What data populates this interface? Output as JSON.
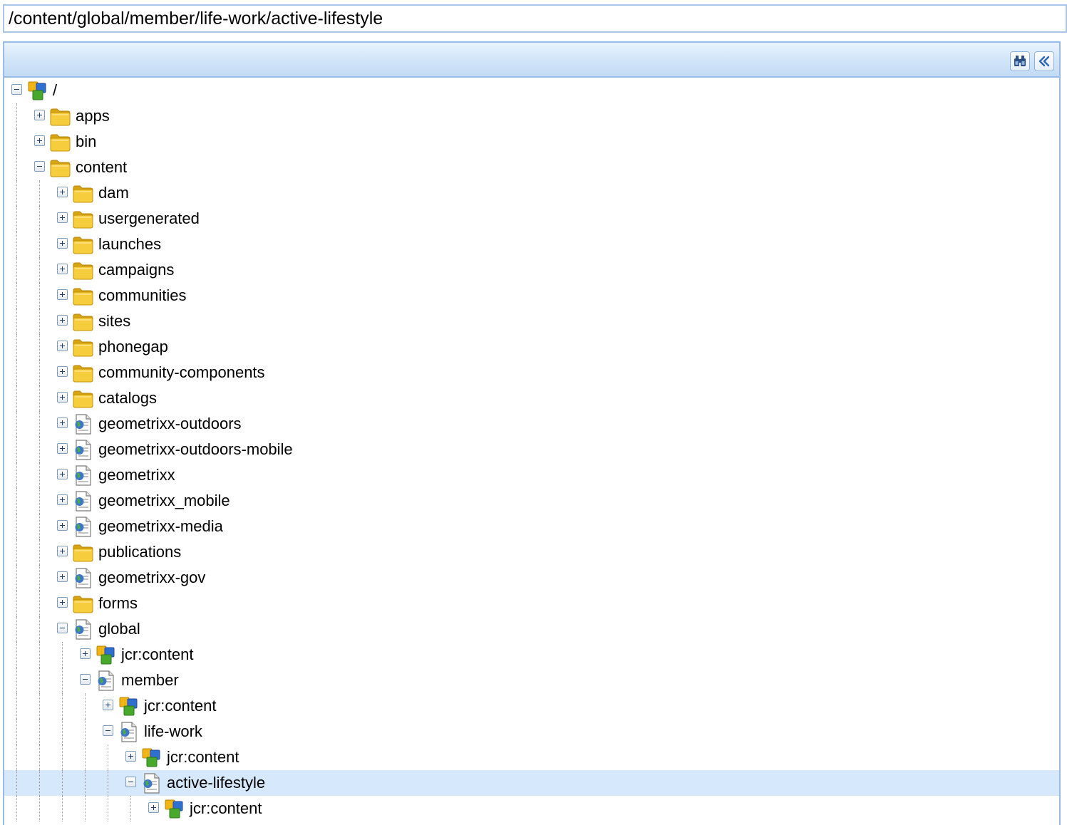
{
  "path_field": {
    "value": "/content/global/member/life-work/active-lifestyle"
  },
  "toolbar": {
    "find_icon": "binoculars-icon",
    "collapse_icon": "double-chevron-left-icon"
  },
  "colors": {
    "toolbar_bg": "#d0e4f8",
    "border": "#99bbe8",
    "selection": "#d6e8fb",
    "folder": "#f3c530"
  },
  "tree": [
    {
      "label": "/",
      "level": 0,
      "icon": "root-node-icon",
      "state": "expanded"
    },
    {
      "label": "apps",
      "level": 1,
      "icon": "folder-icon",
      "state": "collapsed"
    },
    {
      "label": "bin",
      "level": 1,
      "icon": "folder-icon",
      "state": "collapsed"
    },
    {
      "label": "content",
      "level": 1,
      "icon": "folder-icon",
      "state": "expanded"
    },
    {
      "label": "dam",
      "level": 2,
      "icon": "folder-icon",
      "state": "collapsed"
    },
    {
      "label": "usergenerated",
      "level": 2,
      "icon": "folder-icon",
      "state": "collapsed"
    },
    {
      "label": "launches",
      "level": 2,
      "icon": "folder-icon",
      "state": "collapsed"
    },
    {
      "label": "campaigns",
      "level": 2,
      "icon": "folder-icon",
      "state": "collapsed"
    },
    {
      "label": "communities",
      "level": 2,
      "icon": "folder-icon",
      "state": "collapsed"
    },
    {
      "label": "sites",
      "level": 2,
      "icon": "folder-icon",
      "state": "collapsed"
    },
    {
      "label": "phonegap",
      "level": 2,
      "icon": "folder-icon",
      "state": "collapsed"
    },
    {
      "label": "community-components",
      "level": 2,
      "icon": "folder-icon",
      "state": "collapsed"
    },
    {
      "label": "catalogs",
      "level": 2,
      "icon": "folder-icon",
      "state": "collapsed"
    },
    {
      "label": "geometrixx-outdoors",
      "level": 2,
      "icon": "page-icon",
      "state": "collapsed"
    },
    {
      "label": "geometrixx-outdoors-mobile",
      "level": 2,
      "icon": "page-icon",
      "state": "collapsed"
    },
    {
      "label": "geometrixx",
      "level": 2,
      "icon": "page-icon",
      "state": "collapsed"
    },
    {
      "label": "geometrixx_mobile",
      "level": 2,
      "icon": "page-icon",
      "state": "collapsed"
    },
    {
      "label": "geometrixx-media",
      "level": 2,
      "icon": "page-icon",
      "state": "collapsed"
    },
    {
      "label": "publications",
      "level": 2,
      "icon": "folder-icon",
      "state": "collapsed"
    },
    {
      "label": "geometrixx-gov",
      "level": 2,
      "icon": "page-icon",
      "state": "collapsed"
    },
    {
      "label": "forms",
      "level": 2,
      "icon": "folder-icon",
      "state": "collapsed"
    },
    {
      "label": "global",
      "level": 2,
      "icon": "page-icon",
      "state": "expanded"
    },
    {
      "label": "jcr:content",
      "level": 3,
      "icon": "node-icon",
      "state": "collapsed"
    },
    {
      "label": "member",
      "level": 3,
      "icon": "page-icon",
      "state": "expanded"
    },
    {
      "label": "jcr:content",
      "level": 4,
      "icon": "node-icon",
      "state": "collapsed"
    },
    {
      "label": "life-work",
      "level": 4,
      "icon": "page-icon",
      "state": "expanded"
    },
    {
      "label": "jcr:content",
      "level": 5,
      "icon": "node-icon",
      "state": "collapsed"
    },
    {
      "label": "active-lifestyle",
      "level": 5,
      "icon": "page-icon",
      "state": "expanded",
      "selected": true
    },
    {
      "label": "jcr:content",
      "level": 6,
      "icon": "node-icon",
      "state": "collapsed"
    }
  ]
}
